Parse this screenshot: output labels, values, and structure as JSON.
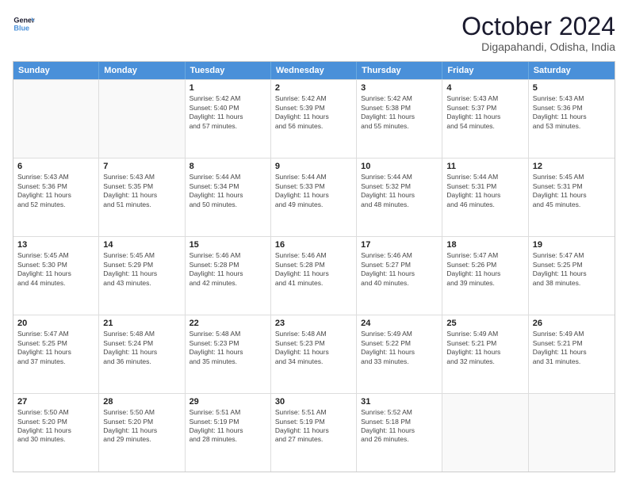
{
  "logo": {
    "line1": "General",
    "line2": "Blue"
  },
  "title": "October 2024",
  "subtitle": "Digapahandi, Odisha, India",
  "header_days": [
    "Sunday",
    "Monday",
    "Tuesday",
    "Wednesday",
    "Thursday",
    "Friday",
    "Saturday"
  ],
  "weeks": [
    [
      {
        "day": "",
        "info": ""
      },
      {
        "day": "",
        "info": ""
      },
      {
        "day": "1",
        "info": "Sunrise: 5:42 AM\nSunset: 5:40 PM\nDaylight: 11 hours\nand 57 minutes."
      },
      {
        "day": "2",
        "info": "Sunrise: 5:42 AM\nSunset: 5:39 PM\nDaylight: 11 hours\nand 56 minutes."
      },
      {
        "day": "3",
        "info": "Sunrise: 5:42 AM\nSunset: 5:38 PM\nDaylight: 11 hours\nand 55 minutes."
      },
      {
        "day": "4",
        "info": "Sunrise: 5:43 AM\nSunset: 5:37 PM\nDaylight: 11 hours\nand 54 minutes."
      },
      {
        "day": "5",
        "info": "Sunrise: 5:43 AM\nSunset: 5:36 PM\nDaylight: 11 hours\nand 53 minutes."
      }
    ],
    [
      {
        "day": "6",
        "info": "Sunrise: 5:43 AM\nSunset: 5:36 PM\nDaylight: 11 hours\nand 52 minutes."
      },
      {
        "day": "7",
        "info": "Sunrise: 5:43 AM\nSunset: 5:35 PM\nDaylight: 11 hours\nand 51 minutes."
      },
      {
        "day": "8",
        "info": "Sunrise: 5:44 AM\nSunset: 5:34 PM\nDaylight: 11 hours\nand 50 minutes."
      },
      {
        "day": "9",
        "info": "Sunrise: 5:44 AM\nSunset: 5:33 PM\nDaylight: 11 hours\nand 49 minutes."
      },
      {
        "day": "10",
        "info": "Sunrise: 5:44 AM\nSunset: 5:32 PM\nDaylight: 11 hours\nand 48 minutes."
      },
      {
        "day": "11",
        "info": "Sunrise: 5:44 AM\nSunset: 5:31 PM\nDaylight: 11 hours\nand 46 minutes."
      },
      {
        "day": "12",
        "info": "Sunrise: 5:45 AM\nSunset: 5:31 PM\nDaylight: 11 hours\nand 45 minutes."
      }
    ],
    [
      {
        "day": "13",
        "info": "Sunrise: 5:45 AM\nSunset: 5:30 PM\nDaylight: 11 hours\nand 44 minutes."
      },
      {
        "day": "14",
        "info": "Sunrise: 5:45 AM\nSunset: 5:29 PM\nDaylight: 11 hours\nand 43 minutes."
      },
      {
        "day": "15",
        "info": "Sunrise: 5:46 AM\nSunset: 5:28 PM\nDaylight: 11 hours\nand 42 minutes."
      },
      {
        "day": "16",
        "info": "Sunrise: 5:46 AM\nSunset: 5:28 PM\nDaylight: 11 hours\nand 41 minutes."
      },
      {
        "day": "17",
        "info": "Sunrise: 5:46 AM\nSunset: 5:27 PM\nDaylight: 11 hours\nand 40 minutes."
      },
      {
        "day": "18",
        "info": "Sunrise: 5:47 AM\nSunset: 5:26 PM\nDaylight: 11 hours\nand 39 minutes."
      },
      {
        "day": "19",
        "info": "Sunrise: 5:47 AM\nSunset: 5:25 PM\nDaylight: 11 hours\nand 38 minutes."
      }
    ],
    [
      {
        "day": "20",
        "info": "Sunrise: 5:47 AM\nSunset: 5:25 PM\nDaylight: 11 hours\nand 37 minutes."
      },
      {
        "day": "21",
        "info": "Sunrise: 5:48 AM\nSunset: 5:24 PM\nDaylight: 11 hours\nand 36 minutes."
      },
      {
        "day": "22",
        "info": "Sunrise: 5:48 AM\nSunset: 5:23 PM\nDaylight: 11 hours\nand 35 minutes."
      },
      {
        "day": "23",
        "info": "Sunrise: 5:48 AM\nSunset: 5:23 PM\nDaylight: 11 hours\nand 34 minutes."
      },
      {
        "day": "24",
        "info": "Sunrise: 5:49 AM\nSunset: 5:22 PM\nDaylight: 11 hours\nand 33 minutes."
      },
      {
        "day": "25",
        "info": "Sunrise: 5:49 AM\nSunset: 5:21 PM\nDaylight: 11 hours\nand 32 minutes."
      },
      {
        "day": "26",
        "info": "Sunrise: 5:49 AM\nSunset: 5:21 PM\nDaylight: 11 hours\nand 31 minutes."
      }
    ],
    [
      {
        "day": "27",
        "info": "Sunrise: 5:50 AM\nSunset: 5:20 PM\nDaylight: 11 hours\nand 30 minutes."
      },
      {
        "day": "28",
        "info": "Sunrise: 5:50 AM\nSunset: 5:20 PM\nDaylight: 11 hours\nand 29 minutes."
      },
      {
        "day": "29",
        "info": "Sunrise: 5:51 AM\nSunset: 5:19 PM\nDaylight: 11 hours\nand 28 minutes."
      },
      {
        "day": "30",
        "info": "Sunrise: 5:51 AM\nSunset: 5:19 PM\nDaylight: 11 hours\nand 27 minutes."
      },
      {
        "day": "31",
        "info": "Sunrise: 5:52 AM\nSunset: 5:18 PM\nDaylight: 11 hours\nand 26 minutes."
      },
      {
        "day": "",
        "info": ""
      },
      {
        "day": "",
        "info": ""
      }
    ]
  ]
}
